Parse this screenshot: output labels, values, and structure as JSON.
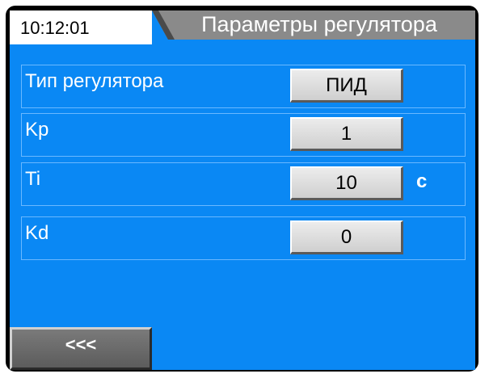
{
  "header": {
    "time": "10:12:01",
    "title": "Параметры регулятора"
  },
  "rows": [
    {
      "label": "Тип регулятора",
      "value": "ПИД",
      "unit": ""
    },
    {
      "label": "Kp",
      "value": "1",
      "unit": ""
    },
    {
      "label": "Ti",
      "value": "10",
      "unit": "с"
    },
    {
      "label": "Kd",
      "value": "0",
      "unit": ""
    }
  ],
  "footer": {
    "back_label": "<<<"
  },
  "colors": {
    "screen_background": "#0a88f4",
    "header_title_bg": "#8a8a8a",
    "button_face": "#dcdcdc"
  }
}
